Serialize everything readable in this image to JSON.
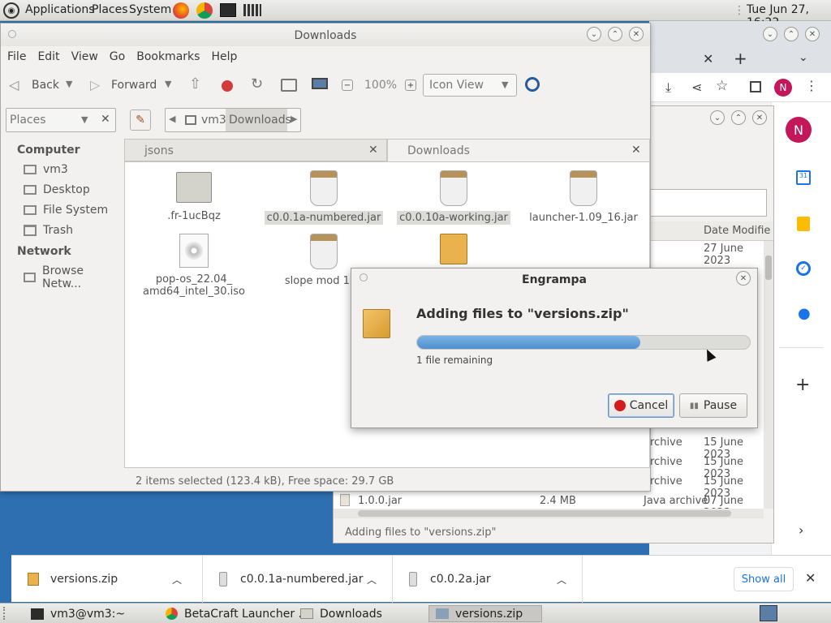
{
  "top_panel": {
    "applications": "Applications",
    "places": "Places",
    "system": "System",
    "clock": "Tue Jun 27, 16:22"
  },
  "caja": {
    "title": "Downloads",
    "menu": [
      "File",
      "Edit",
      "View",
      "Go",
      "Bookmarks",
      "Help"
    ],
    "toolbar": {
      "back": "Back",
      "forward": "Forward",
      "zoom": "100%",
      "view_mode": "Icon View"
    },
    "places_label": "Places",
    "path": [
      "vm3",
      "Downloads"
    ],
    "tabs": [
      "jsons",
      "Downloads"
    ],
    "sidebar": {
      "computer_header": "Computer",
      "computer_items": [
        "vm3",
        "Desktop",
        "File System",
        "Trash"
      ],
      "network_header": "Network",
      "network_items": [
        "Browse Netw..."
      ]
    },
    "files": [
      {
        "name": ".fr-1ucBqz",
        "type": "folder"
      },
      {
        "name": "c0.0.1a-numbered.jar",
        "type": "jar",
        "selected": true
      },
      {
        "name": "c0.0.10a-working.jar",
        "type": "jar",
        "selected": true
      },
      {
        "name": "launcher-1.09_16.jar",
        "type": "jar"
      },
      {
        "name": "pop-os_22.04_\namd64_intel_30.iso",
        "type": "iso"
      },
      {
        "name": "slope mod 11a",
        "type": "jar"
      },
      {
        "name": "",
        "type": "archive"
      }
    ],
    "status": "2 items selected (123.4 kB), Free space: 29.7 GB"
  },
  "archive_window": {
    "column_header_date": "Date Modifie",
    "rows": [
      {
        "name": "",
        "size": "",
        "type": "",
        "date": "27 June 2023"
      },
      {
        "name": "",
        "size": "",
        "type": "rchive",
        "date": "15 June 2023"
      },
      {
        "name": "",
        "size": "",
        "type": "rchive",
        "date": "15 June 2023"
      },
      {
        "name": "",
        "size": "",
        "type": "rchive",
        "date": "15 June 2023"
      },
      {
        "name": "1.0.0.jar",
        "size": "2.4 MB",
        "type": "Java archive",
        "date": "07 June 2023"
      }
    ],
    "status": "Adding files to \"versions.zip\""
  },
  "dialog": {
    "title": "Engrampa",
    "heading": "Adding files to \"versions.zip\"",
    "remaining": "1 file remaining",
    "progress": 0.67,
    "cancel": "Cancel",
    "pause": "Pause"
  },
  "chrome": {
    "avatar_letter": "N"
  },
  "downloads_bar": {
    "items": [
      "versions.zip",
      "c0.0.1a-numbered.jar",
      "c0.0.2a.jar"
    ],
    "show_all": "Show all"
  },
  "taskbar": {
    "tasks": [
      "vm3@vm3:~",
      "BetaCraft Launcher ...",
      "Downloads",
      "versions.zip"
    ]
  },
  "colors": {
    "progress": "#5b9bd8",
    "accent": "#1a73e8",
    "avatar": "#c2185b"
  }
}
